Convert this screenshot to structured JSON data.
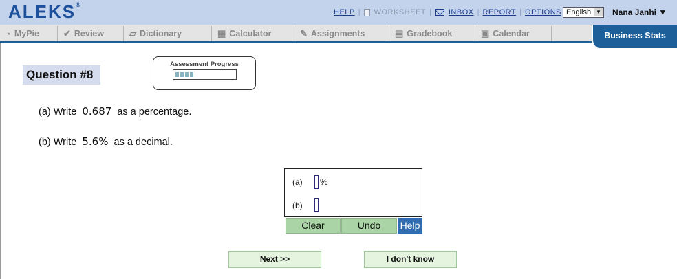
{
  "header": {
    "logo": "ALEKS",
    "logo_mark": "®",
    "links": {
      "help": "HELP",
      "worksheet": "WORKSHEET",
      "inbox": "INBOX",
      "report": "REPORT",
      "options": "OPTIONS"
    },
    "language": "English",
    "user_name": "Nana Janhi",
    "user_arrow": "▼"
  },
  "tabs": [
    {
      "label": "MyPie",
      "icon": "pie-icon"
    },
    {
      "label": "Review",
      "icon": "check-icon"
    },
    {
      "label": "Dictionary",
      "icon": "book-icon"
    },
    {
      "label": "Calculator",
      "icon": "calculator-icon"
    },
    {
      "label": "Assignments",
      "icon": "pencil-icon"
    },
    {
      "label": "Gradebook",
      "icon": "grid-icon"
    },
    {
      "label": "Calendar",
      "icon": "calendar-icon"
    }
  ],
  "course_tab": "Business Stats",
  "question": {
    "title": "Question #8",
    "progress_label": "Assessment Progress",
    "progress_segments": 4,
    "part_a": {
      "prefix": "(a) Write",
      "value": "0.687",
      "suffix": "as a percentage."
    },
    "part_b": {
      "prefix": "(b) Write",
      "value": "5.6%",
      "suffix": "as a decimal."
    }
  },
  "answer": {
    "label_a": "(a)",
    "unit_a": "%",
    "label_b": "(b)",
    "value_a": "",
    "value_b": ""
  },
  "tools": {
    "clear": "Clear",
    "undo": "Undo",
    "help": "Help"
  },
  "nav": {
    "next": "Next >>",
    "dont_know": "I don't know"
  },
  "colors": {
    "header_bg": "#c3d3ec",
    "brand": "#1c4f9c",
    "course_tab_bg": "#1c5f99",
    "tool_button": "#aad4a6",
    "help_button": "#2f6db0",
    "nav_button": "#e4f4df"
  }
}
